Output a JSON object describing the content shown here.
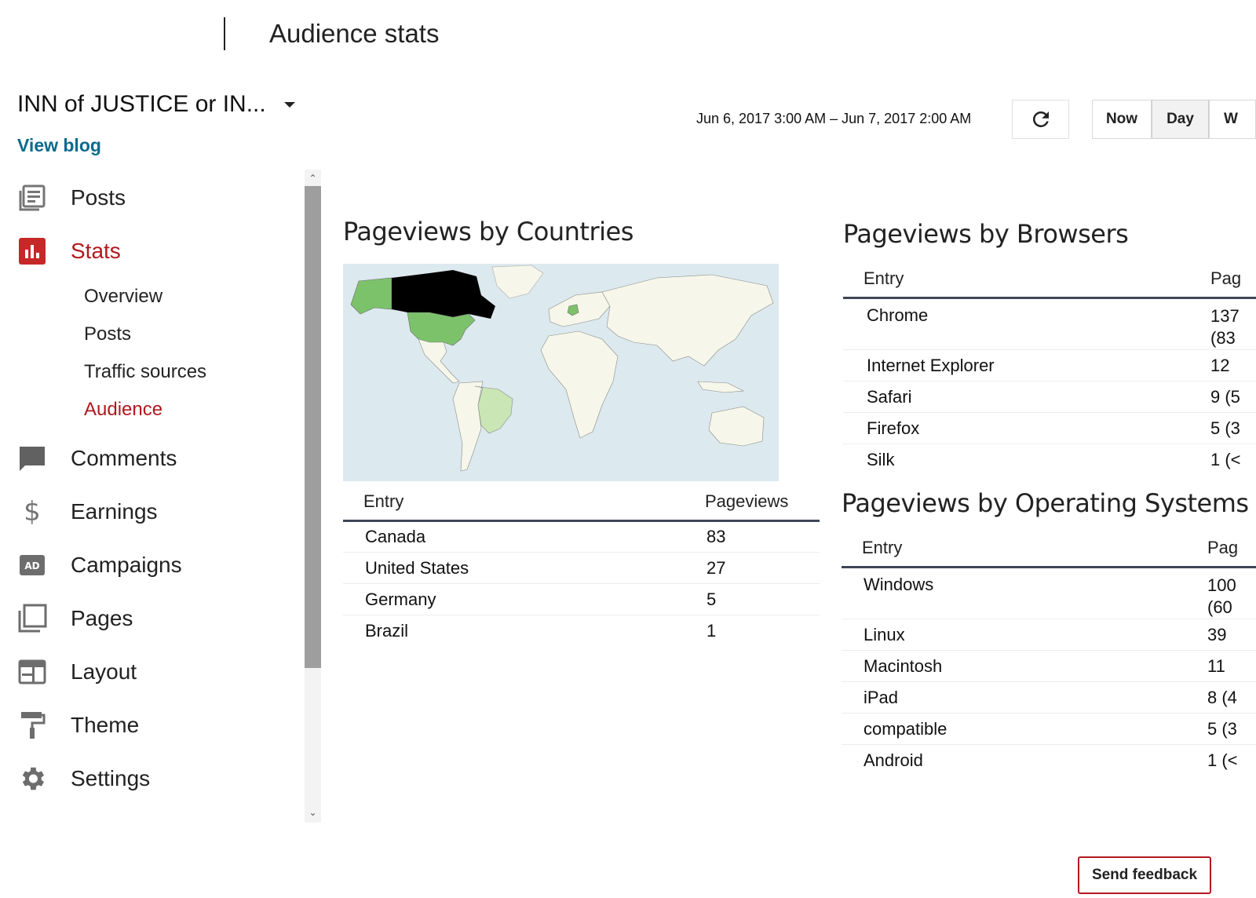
{
  "header": {
    "title": "Audience stats"
  },
  "blog": {
    "name": "INN of JUSTICE or IN...",
    "view_blog": "View blog"
  },
  "toolbar": {
    "date_range": "Jun 6, 2017 3:00 AM – Jun 7, 2017 2:00 AM",
    "now": "Now",
    "day": "Day",
    "week_partial": "W"
  },
  "sidebar": {
    "items": [
      {
        "label": "Posts",
        "icon": "posts-icon"
      },
      {
        "label": "Stats",
        "icon": "stats-icon",
        "active": true
      },
      {
        "label": "Comments",
        "icon": "comments-icon"
      },
      {
        "label": "Earnings",
        "icon": "dollar-icon"
      },
      {
        "label": "Campaigns",
        "icon": "ad-icon"
      },
      {
        "label": "Pages",
        "icon": "pages-icon"
      },
      {
        "label": "Layout",
        "icon": "layout-icon"
      },
      {
        "label": "Theme",
        "icon": "paint-roller-icon"
      },
      {
        "label": "Settings",
        "icon": "gear-icon"
      }
    ],
    "stats_sub": [
      "Overview",
      "Posts",
      "Traffic sources",
      "Audience"
    ]
  },
  "countries": {
    "title": "Pageviews by Countries",
    "columns": [
      "Entry",
      "Pageviews"
    ],
    "rows": [
      {
        "entry": "Canada",
        "value": "83"
      },
      {
        "entry": "United States",
        "value": "27"
      },
      {
        "entry": "Germany",
        "value": "5"
      },
      {
        "entry": "Brazil",
        "value": "1"
      }
    ],
    "map_colors": {
      "top": "#000000",
      "mid": "#7cc26b",
      "low": "#c9e6b4",
      "none": "#f6f7ea",
      "water": "#dce9ee"
    }
  },
  "browsers": {
    "title": "Pageviews by Browsers",
    "columns": [
      "Entry",
      "Pag"
    ],
    "rows": [
      {
        "entry": "Chrome",
        "value": "137",
        "value2": "(83"
      },
      {
        "entry": "Internet Explorer",
        "value": "12",
        "value2": ""
      },
      {
        "entry": "Safari",
        "value": "9 (5",
        "value2": ""
      },
      {
        "entry": "Firefox",
        "value": "5 (3",
        "value2": ""
      },
      {
        "entry": "Silk",
        "value": "1 (<",
        "value2": ""
      }
    ]
  },
  "os": {
    "title": "Pageviews by Operating Systems",
    "columns": [
      "Entry",
      "Pag"
    ],
    "rows": [
      {
        "entry": "Windows",
        "value": "100",
        "value2": "(60"
      },
      {
        "entry": "Linux",
        "value": "39",
        "value2": ""
      },
      {
        "entry": "Macintosh",
        "value": "11",
        "value2": ""
      },
      {
        "entry": "iPad",
        "value": "8 (4",
        "value2": ""
      },
      {
        "entry": "compatible",
        "value": "5 (3",
        "value2": ""
      },
      {
        "entry": "Android",
        "value": "1 (<",
        "value2": ""
      }
    ]
  },
  "feedback": {
    "label": "Send feedback"
  },
  "accent_color": "#b1181e",
  "link_color": "#0b6a8c"
}
